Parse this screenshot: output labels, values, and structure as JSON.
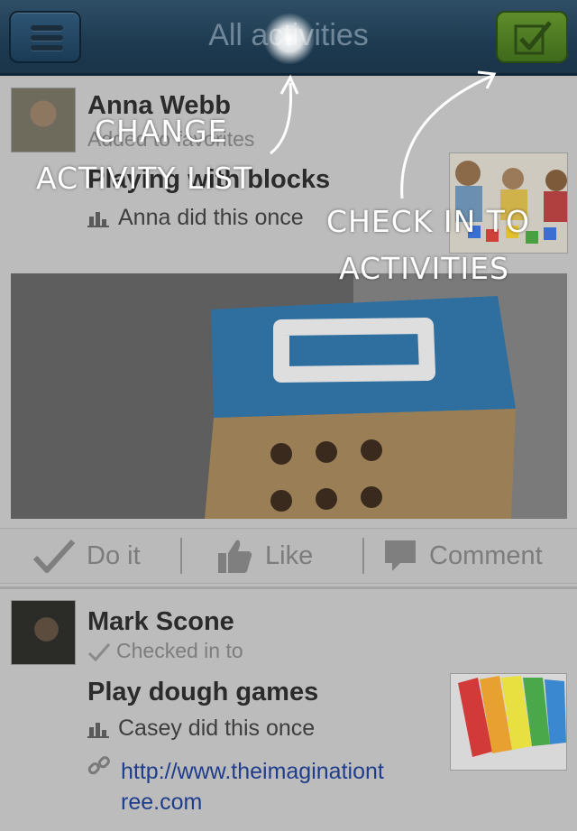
{
  "header": {
    "title": "All activities",
    "menu_icon": "hamburger-menu-icon",
    "checkin_icon": "checkbox-check-icon",
    "checkin_color": "#4f7d24",
    "bar_color": "#1d3a50"
  },
  "feed": [
    {
      "author": "Anna Webb",
      "action": "Added to favorites",
      "activity": "Playing with blocks",
      "stat": "Anna did this once"
    },
    {
      "author": "Mark Scone",
      "action": "Checked in to",
      "activity": "Play dough games",
      "stat": "Casey did this once",
      "link": "http://www.theimaginationtree.com",
      "link_line1": "http://www.theimaginationt",
      "link_line2": "ree.com"
    }
  ],
  "actions": {
    "do_it": "Do it",
    "like": "Like",
    "comment": "Comment"
  },
  "annotations": {
    "change_line1": "CHANGE",
    "change_line2": "ACTIVITY LIST",
    "checkin_line1": "CHECK IN TO",
    "checkin_line2": "ACTIVITIES"
  }
}
